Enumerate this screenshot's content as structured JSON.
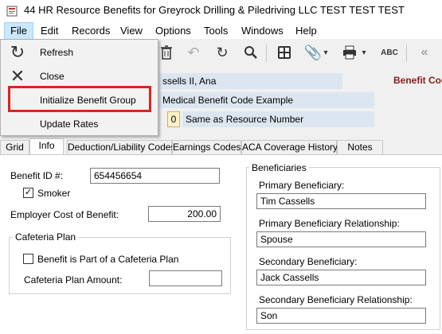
{
  "window": {
    "title": "44 HR Resource Benefits for Greyrock Drilling & Piledriving LLC TEST TEST TEST"
  },
  "menubar": {
    "items": [
      "File",
      "Edit",
      "Records",
      "View",
      "Options",
      "Tools",
      "Windows",
      "Help"
    ]
  },
  "file_menu": {
    "items": [
      "Refresh",
      "Close",
      "Initialize Benefit Group",
      "Update Rates"
    ]
  },
  "header": {
    "resource_name": "ssells II, Ana",
    "benefit_code_label": "Benefit Cod",
    "benefit_description": "Medical Benefit Code Example",
    "sequence_value": "0",
    "sequence_description": "Same as Resource Number"
  },
  "tabs": [
    "Grid",
    "Info",
    "Deduction/Liability Codes",
    "Earnings Codes",
    "ACA Coverage History",
    "Notes"
  ],
  "active_tab": "Info",
  "info": {
    "benefit_id_label": "Benefit ID #:",
    "benefit_id_value": "654456654",
    "smoker_label": "Smoker",
    "smoker_checked": true,
    "employer_cost_label": "Employer Cost of Benefit:",
    "employer_cost_value": "200.00",
    "cafeteria": {
      "group_title": "Cafeteria Plan",
      "part_of_label": "Benefit is Part of a Cafeteria Plan",
      "part_of_checked": false,
      "amount_label": "Cafeteria Plan Amount:",
      "amount_value": ""
    }
  },
  "beneficiaries": {
    "group_title": "Beneficiaries",
    "primary_label": "Primary Beneficiary:",
    "primary_value": "Tim Cassells",
    "primary_rel_label": "Primary Beneficiary Relationship:",
    "primary_rel_value": "Spouse",
    "secondary_label": "Secondary Beneficiary:",
    "secondary_value": "Jack Cassells",
    "secondary_rel_label": "Secondary Beneficiary Relationship:",
    "secondary_rel_value": "Son"
  },
  "colors": {
    "highlight": "#e0221e",
    "benefit_code_label": "#8b1a1a",
    "header_field_bg": "#dce6f0",
    "menu_active": "#cce8ff"
  }
}
